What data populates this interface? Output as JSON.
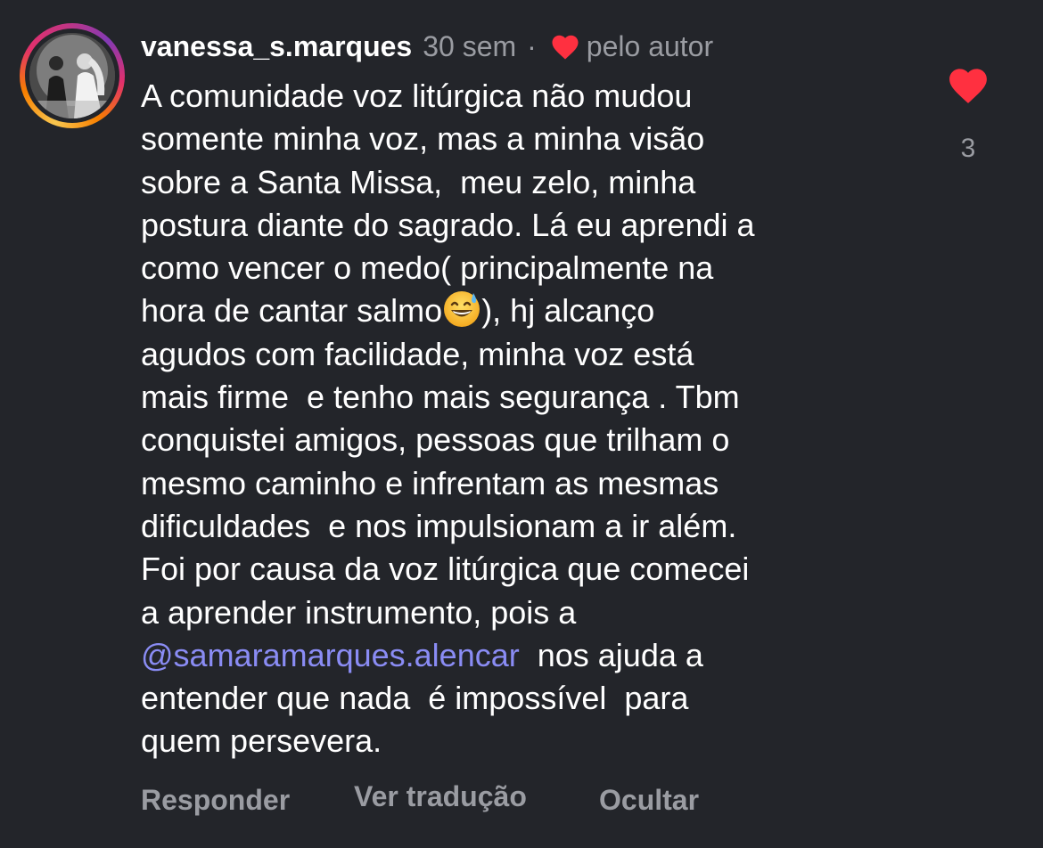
{
  "comment": {
    "username": "vanessa_s.marques",
    "time": "30 sem",
    "separator": "·",
    "liked_by_author_label": "pelo autor",
    "lines": [
      "A comunidade voz litúrgica não mudou",
      "somente minha voz, mas a minha visão",
      "sobre a Santa Missa,  meu zelo, minha",
      "postura diante do sagrado. Lá eu aprendi a",
      "como vencer o medo( principalmente na",
      "agudos com facilidade, minha voz está",
      "mais firme  e tenho mais segurança . Tbm",
      "conquistei amigos, pessoas que trilham o",
      "mesmo caminho e infrentam as mesmas",
      "dificuldades  e nos impulsionam a ir além.",
      "Foi por causa da voz litúrgica que comecei",
      "a aprender instrumento, pois a",
      "entender que nada  é impossível  para",
      "quem persevera."
    ],
    "emoji_line": {
      "before": "hora de cantar salmo",
      "emoji_icon": "grinning-face-with-sweat-emoji",
      "after": "), hj alcanço"
    },
    "mention_line": {
      "mention": "@samaramarques.alencar",
      "after": "  nos ajuda a"
    },
    "like_count": "3",
    "actions": {
      "reply": "Responder",
      "translate": "Ver tradução",
      "hide": "Ocultar"
    }
  },
  "colors": {
    "background": "#23252a",
    "text": "#ffffff",
    "muted": "#9a9ca2",
    "heart": "#ff3040",
    "mention": "#8a8cf4"
  },
  "icons": {
    "author_like": "heart-icon",
    "like": "heart-icon"
  }
}
